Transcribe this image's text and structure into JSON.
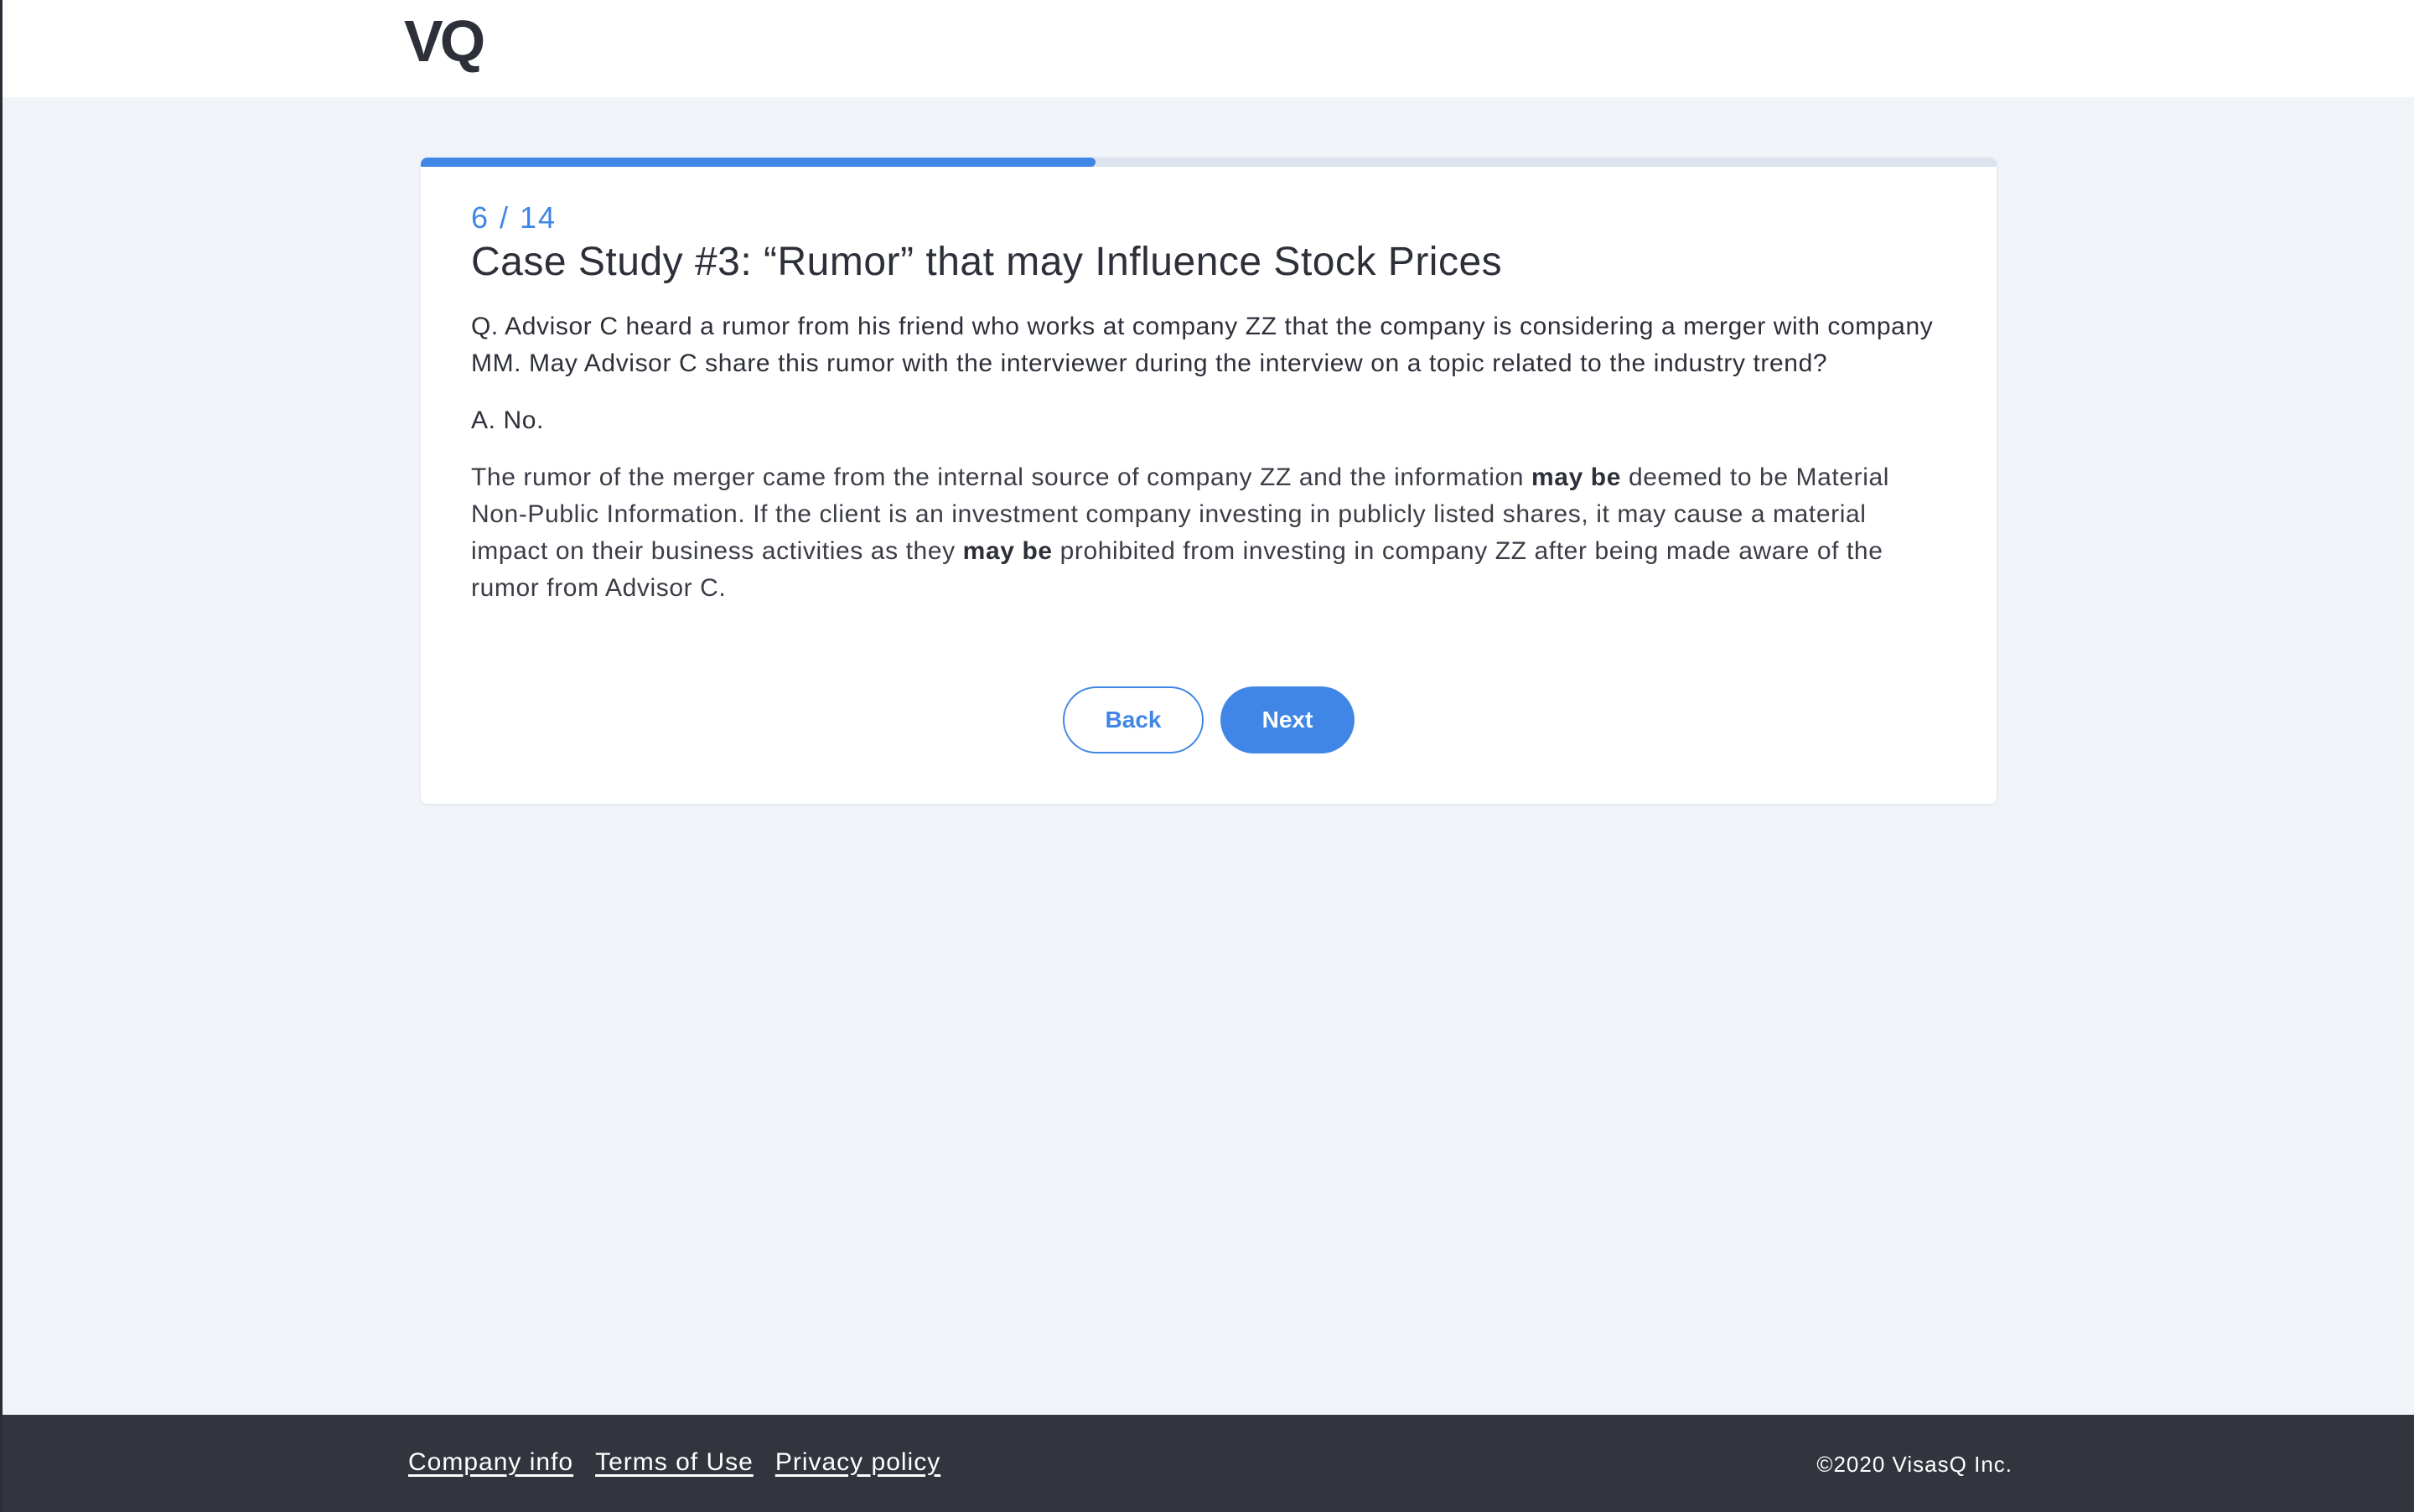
{
  "header": {
    "logo_text": "VQ"
  },
  "progress": {
    "current": 6,
    "total": 14,
    "fill_fraction": 0.428
  },
  "card": {
    "step_label": "6 / 14",
    "title": "Case Study #3: “Rumor” that may Influence Stock Prices",
    "question": "Q. Advisor C heard a rumor from his friend who works at company ZZ that the company is considering a merger with company MM. May Advisor C share this rumor with the interviewer during the interview on a topic related to the industry trend?",
    "answer": "A. No.",
    "explanation": {
      "part1": "The rumor of the merger came from the internal source of company ZZ and the information ",
      "bold1": "may be",
      "part2": " deemed to be Material Non-Public Information. If the client is an investment company investing in publicly listed shares, it may cause a material impact on their business activities as they ",
      "bold2": "may be",
      "part3": " prohibited from investing in company ZZ after being made aware of the rumor from Advisor C."
    },
    "back_label": "Back",
    "next_label": "Next"
  },
  "footer": {
    "links": [
      "Company info",
      "Terms of Use",
      "Privacy policy"
    ],
    "copyright": "©2020 VisasQ Inc."
  },
  "colors": {
    "accent": "#3f86e6",
    "page_bg": "#f0f4f8",
    "footer_bg": "#32353d",
    "text": "#2d3039"
  }
}
